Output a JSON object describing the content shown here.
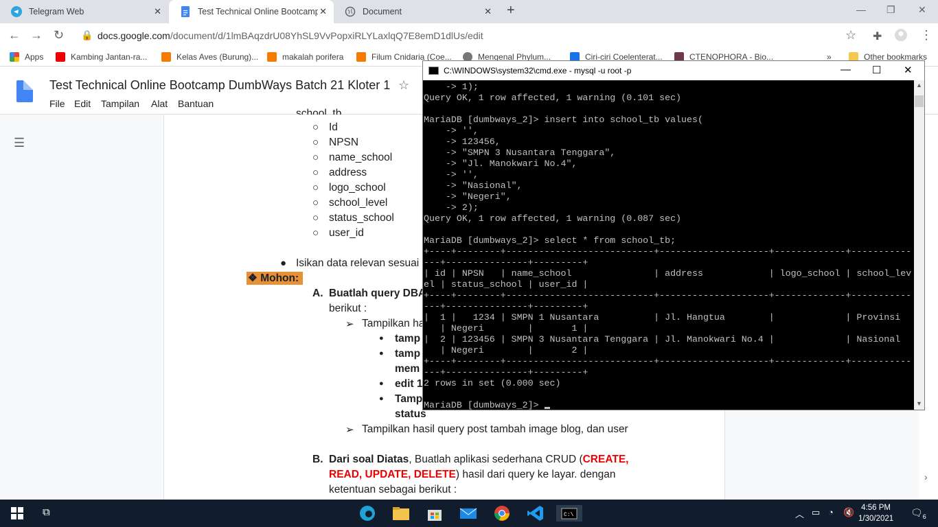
{
  "browser": {
    "tabs": [
      {
        "label": "Telegram Web",
        "active": false
      },
      {
        "label": "Test Technical Online Bootcamp D",
        "active": true
      },
      {
        "label": "Document",
        "active": false
      }
    ],
    "url_host": "docs.google.com",
    "url_path": "/document/d/1lmBAqzdrU08YhSL9VvPopxiRLYLaxlqQ7E8emD1dlUs/edit",
    "bookmarks": [
      "Apps",
      "Kambing Jantan-ra...",
      "Kelas Aves (Burung)...",
      "makalah porifera",
      "Filum Cnidaria (Coe...",
      "Mengenal Phylum...",
      "Ciri-ciri Coelenterat...",
      "CTENOPHORA - Bio...",
      "»",
      "Other bookmarks"
    ]
  },
  "docs": {
    "title": "Test Technical Online Bootcamp DumbWays Batch 21 Kloter 1",
    "menu": [
      "File",
      "Edit",
      "Tampilan",
      "Alat",
      "Bantuan"
    ],
    "cut_heading": "school_tb",
    "fields": [
      "Id",
      "NPSN",
      "name_school",
      "address",
      "logo_school",
      "school_level",
      "status_school",
      "user_id"
    ],
    "isikan": "Isikan data relevan sesuai",
    "mohon": "❖ Mohon:",
    "a_label": "A.",
    "a_text": "Buatlah query DBA",
    "a_cont": "berikut :",
    "tampilkan_ha": "Tampilkan ha",
    "sub_items": [
      "tamp",
      "tamp",
      "mem",
      "edit 1",
      "Tamp",
      "status"
    ],
    "tampilkan_post": "Tampilkan hasil query post tambah image blog, dan user",
    "b_label": "B.",
    "b_bold": "Dari soal Diatas",
    "b_text1": ", Buatlah aplikasi sederhana CRUD (",
    "b_red1": "CREATE,",
    "b_red2": "READ, UPDATE, DELETE",
    "b_text2": ") hasil dari query ke layar. dengan",
    "b_text3": "ketentuan sebagai berikut :"
  },
  "cmd": {
    "title": "C:\\WINDOWS\\system32\\cmd.exe - mysql  -u root -p",
    "lines": [
      "    -> 1);",
      "Query OK, 1 row affected, 1 warning (0.101 sec)",
      "",
      "MariaDB [dumbways_2]> insert into school_tb values(",
      "    -> '',",
      "    -> 123456,",
      "    -> \"SMPN 3 Nusantara Tenggara\",",
      "    -> \"Jl. Manokwari No.4\",",
      "    -> '',",
      "    -> \"Nasional\",",
      "    -> \"Negeri\",",
      "    -> 2);",
      "Query OK, 1 row affected, 1 warning (0.087 sec)",
      "",
      "MariaDB [dumbways_2]> select * from school_tb;",
      "+----+--------+---------------------------+--------------------+-------------+-----------",
      "---+---------------+---------+",
      "| id | NPSN   | name_school               | address            | logo_school | school_lev",
      "el | status_school | user_id |",
      "+----+--------+---------------------------+--------------------+-------------+-----------",
      "---+---------------+---------+",
      "|  1 |   1234 | SMPN 1 Nusantara          | Jl. Hangtua        |             | Provinsi",
      "   | Negeri        |       1 |",
      "|  2 | 123456 | SMPN 3 Nusantara Tenggara | Jl. Manokwari No.4 |             | Nasional",
      "   | Negeri        |       2 |",
      "+----+--------+---------------------------+--------------------+-------------+-----------",
      "---+---------------+---------+",
      "2 rows in set (0.000 sec)",
      "",
      "MariaDB [dumbways_2]> "
    ]
  },
  "taskbar": {
    "time": "4:56 PM",
    "date": "1/30/2021",
    "notif_count": "6"
  },
  "colors": {
    "docs_blue": "#4285f4",
    "mohon_bg": "#e69138",
    "taskbar": "#111d2c"
  }
}
